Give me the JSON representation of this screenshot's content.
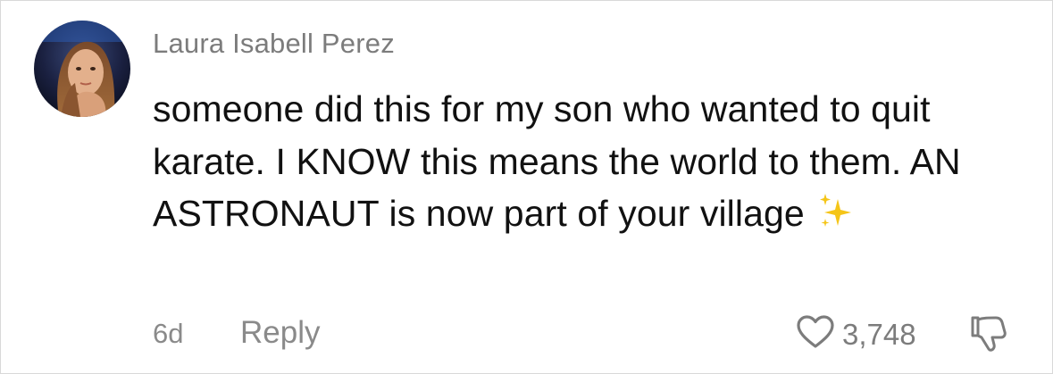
{
  "comment": {
    "author": "Laura Isabell Perez",
    "text": "someone did this for my son who wanted to quit karate. I KNOW this means the world to them. AN ASTRONAUT is now part of your village",
    "emoji": "sparkles-emoji",
    "time_ago": "6d",
    "reply_label": "Reply",
    "like_count": "3,748",
    "icons": {
      "like": "heart-outline-icon",
      "dislike": "thumbs-down-icon"
    }
  },
  "colors": {
    "author": "#7c7c7c",
    "text": "#111111",
    "meta": "#8a8a8a",
    "sparkle": "#f5c518"
  }
}
